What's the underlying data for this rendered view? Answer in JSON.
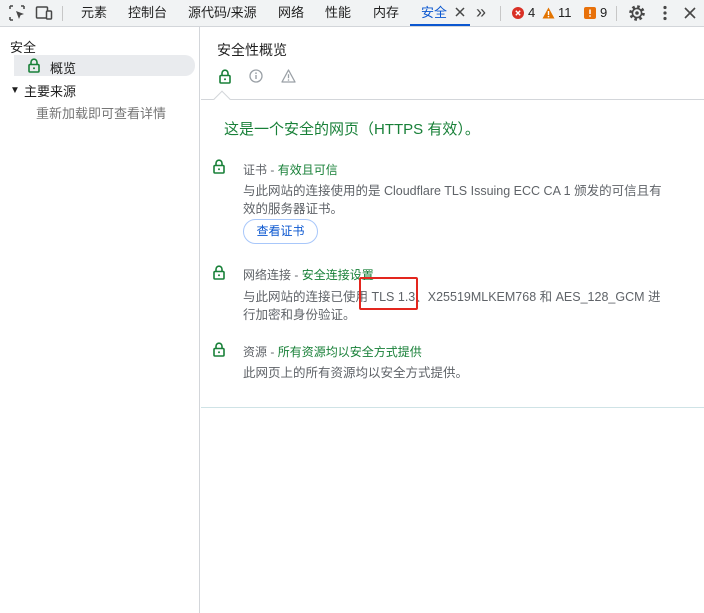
{
  "toolbar": {
    "tabs": [
      {
        "label": "元素"
      },
      {
        "label": "控制台"
      },
      {
        "label": "源代码/来源"
      },
      {
        "label": "网络"
      },
      {
        "label": "性能"
      },
      {
        "label": "内存"
      },
      {
        "label": "安全"
      }
    ],
    "overflow_label": "»",
    "errors_count": "4",
    "warnings_count": "11",
    "issues_count": "9",
    "icons": [
      "inspect-element-icon",
      "device-toolbar-icon",
      "close-icon",
      "more-tabs-icon",
      "error-icon",
      "warning-icon",
      "issue-flag-icon",
      "gear-icon",
      "kebab-menu-icon",
      "close-devtools-icon"
    ],
    "colors": {
      "accent": "#0b57d0",
      "error": "#d93025",
      "warning": "#e37400",
      "issue": "#e8710a"
    }
  },
  "sidebar": {
    "heading": "安全",
    "overview": "概览",
    "origins_heading": "主要来源",
    "reload_hint": "重新加载即可查看详情"
  },
  "main": {
    "title": "安全性概览",
    "summary": "这是一个安全的网页（HTTPS 有效）。",
    "sections": {
      "certificate": {
        "label": "证书",
        "separator": " - ",
        "status": "有效且可信",
        "description": "与此网站的连接使用的是 Cloudflare TLS Issuing ECC CA 1 颁发的可信且有效的服务器证书。",
        "button": "查看证书"
      },
      "connection": {
        "label": "网络连接",
        "separator": " - ",
        "status": "安全连接设置",
        "description": "与此网站的连接已使用 TLS 1.3、X25519MLKEM768 和 AES_128_GCM 进行加密和身份验证。"
      },
      "resources": {
        "label": "资源",
        "separator": " - ",
        "status": "所有资源均以安全方式提供",
        "description": "此网页上的所有资源均以安全方式提供。"
      }
    },
    "colors": {
      "secure": "#188038",
      "highlight_box": "#e3261e"
    }
  }
}
